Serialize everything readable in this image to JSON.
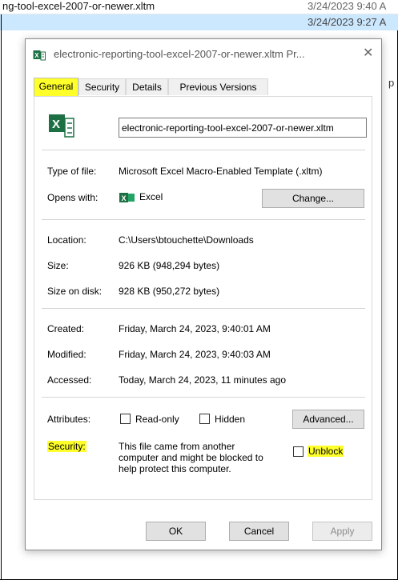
{
  "background": {
    "row1_name": "ng-tool-excel-2007-or-newer.xltm",
    "row1_date": "3/24/2023 9:40 A",
    "row2_date": "3/24/2023 9:27 A",
    "side_text": "p"
  },
  "dialog": {
    "title": "electronic-reporting-tool-excel-2007-or-newer.xltm Pr...",
    "tabs": [
      "General",
      "Security",
      "Details",
      "Previous Versions"
    ],
    "active_tab": "General",
    "filename": "electronic-reporting-tool-excel-2007-or-newer.xltm",
    "type_label": "Type of file:",
    "type_value": "Microsoft Excel Macro-Enabled Template (.xltm)",
    "opens_label": "Opens with:",
    "opens_value": "Excel",
    "change_button": "Change...",
    "location_label": "Location:",
    "location_value": "C:\\Users\\btouchette\\Downloads",
    "size_label": "Size:",
    "size_value": "926 KB (948,294 bytes)",
    "size_disk_label": "Size on disk:",
    "size_disk_value": "928 KB (950,272 bytes)",
    "created_label": "Created:",
    "created_value": "Friday, March 24, 2023, 9:40:01 AM",
    "modified_label": "Modified:",
    "modified_value": "Friday, March 24, 2023, 9:40:03 AM",
    "accessed_label": "Accessed:",
    "accessed_value": "Today, March 24, 2023, 11 minutes ago",
    "attributes_label": "Attributes:",
    "readonly_label": "Read-only",
    "hidden_label": "Hidden",
    "advanced_button": "Advanced...",
    "security_label": "Security:",
    "security_line1": "This file came from another",
    "security_line2": "computer and might be blocked to",
    "security_line3": "help protect this computer.",
    "unblock_label": "Unblock",
    "ok_button": "OK",
    "cancel_button": "Cancel",
    "apply_button": "Apply",
    "highlight_color": "#ffff2a"
  }
}
